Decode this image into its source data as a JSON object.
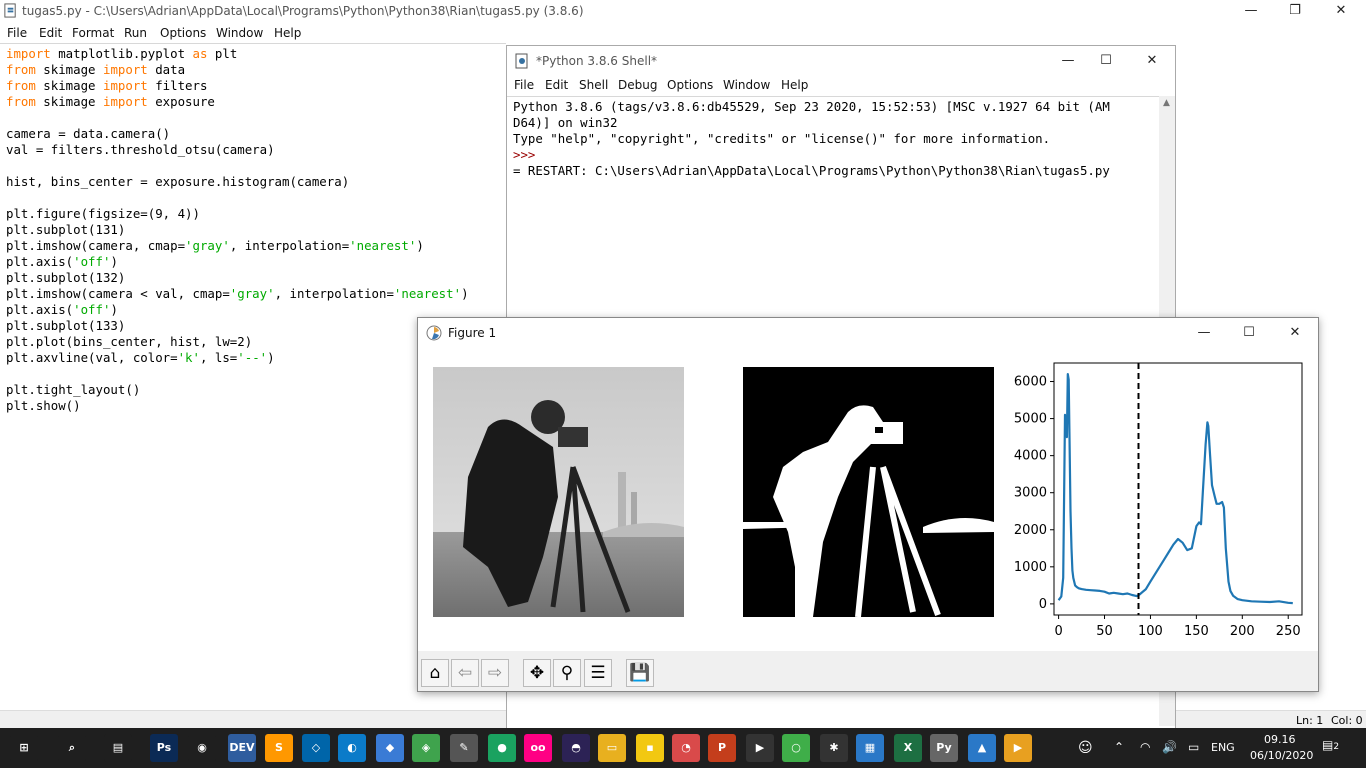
{
  "editor_window": {
    "title": "tugas5.py - C:\\Users\\Adrian\\AppData\\Local\\Programs\\Python\\Python38\\Rian\\tugas5.py (3.8.6)",
    "menu": [
      "File",
      "Edit",
      "Format",
      "Run",
      "Options",
      "Window",
      "Help"
    ],
    "code": [
      [
        {
          "t": "import",
          "c": "kw"
        },
        {
          "t": " matplotlib.pyplot ",
          "c": ""
        },
        {
          "t": "as",
          "c": "kw"
        },
        {
          "t": " plt",
          "c": ""
        }
      ],
      [
        {
          "t": "from",
          "c": "kw"
        },
        {
          "t": " skimage ",
          "c": ""
        },
        {
          "t": "import",
          "c": "kw"
        },
        {
          "t": " data",
          "c": ""
        }
      ],
      [
        {
          "t": "from",
          "c": "kw"
        },
        {
          "t": " skimage ",
          "c": ""
        },
        {
          "t": "import",
          "c": "kw"
        },
        {
          "t": " filters",
          "c": ""
        }
      ],
      [
        {
          "t": "from",
          "c": "kw"
        },
        {
          "t": " skimage ",
          "c": ""
        },
        {
          "t": "import",
          "c": "kw"
        },
        {
          "t": " exposure",
          "c": ""
        }
      ],
      [],
      [
        {
          "t": "camera = data.camera()",
          "c": ""
        }
      ],
      [
        {
          "t": "val = filters.threshold_otsu(camera)",
          "c": ""
        }
      ],
      [],
      [
        {
          "t": "hist, bins_center = exposure.histogram(camera)",
          "c": ""
        }
      ],
      [],
      [
        {
          "t": "plt.figure(figsize=(9, 4))",
          "c": ""
        }
      ],
      [
        {
          "t": "plt.subplot(131)",
          "c": ""
        }
      ],
      [
        {
          "t": "plt.imshow(camera, cmap=",
          "c": ""
        },
        {
          "t": "'gray'",
          "c": "str"
        },
        {
          "t": ", interpolation=",
          "c": ""
        },
        {
          "t": "'nearest'",
          "c": "str"
        },
        {
          "t": ")",
          "c": ""
        }
      ],
      [
        {
          "t": "plt.axis(",
          "c": ""
        },
        {
          "t": "'off'",
          "c": "str"
        },
        {
          "t": ")",
          "c": ""
        }
      ],
      [
        {
          "t": "plt.subplot(132)",
          "c": ""
        }
      ],
      [
        {
          "t": "plt.imshow(camera < val, cmap=",
          "c": ""
        },
        {
          "t": "'gray'",
          "c": "str"
        },
        {
          "t": ", interpolation=",
          "c": ""
        },
        {
          "t": "'nearest'",
          "c": "str"
        },
        {
          "t": ")",
          "c": ""
        }
      ],
      [
        {
          "t": "plt.axis(",
          "c": ""
        },
        {
          "t": "'off'",
          "c": "str"
        },
        {
          "t": ")",
          "c": ""
        }
      ],
      [
        {
          "t": "plt.subplot(133)",
          "c": ""
        }
      ],
      [
        {
          "t": "plt.plot(bins_center, hist, lw=2)",
          "c": ""
        }
      ],
      [
        {
          "t": "plt.axvline(val, color=",
          "c": ""
        },
        {
          "t": "'k'",
          "c": "str"
        },
        {
          "t": ", ls=",
          "c": ""
        },
        {
          "t": "'--'",
          "c": "str"
        },
        {
          "t": ")",
          "c": ""
        }
      ],
      [],
      [
        {
          "t": "plt.tight_layout()",
          "c": ""
        }
      ],
      [
        {
          "t": "plt.show()",
          "c": ""
        }
      ]
    ],
    "status": {
      "line": "Ln: 1",
      "col": "Col: 0"
    }
  },
  "shell_window": {
    "title": "*Python 3.8.6 Shell*",
    "menu": [
      "File",
      "Edit",
      "Shell",
      "Debug",
      "Options",
      "Window",
      "Help"
    ],
    "lines": [
      "Python 3.8.6 (tags/v3.8.6:db45529, Sep 23 2020, 15:52:53) [MSC v.1927 64 bit (AM",
      "D64)] on win32",
      "Type \"help\", \"copyright\", \"credits\" or \"license()\" for more information.",
      ">>>",
      "= RESTART: C:\\Users\\Adrian\\AppData\\Local\\Programs\\Python\\Python38\\Rian\\tugas5.py"
    ]
  },
  "figure_window": {
    "title": "Figure 1",
    "toolbar_icons": [
      "home-icon",
      "back-arrow-icon",
      "forward-arrow-icon",
      "pan-icon",
      "zoom-icon",
      "configure-subplots-icon",
      "save-icon"
    ]
  },
  "chart_data": {
    "type": "line",
    "title": "",
    "xlabel": "",
    "ylabel": "",
    "x_ticks": [
      "0",
      "50",
      "100",
      "150",
      "200",
      "250"
    ],
    "y_ticks": [
      "0",
      "1000",
      "2000",
      "3000",
      "4000",
      "5000",
      "6000"
    ],
    "xlim": [
      -5,
      265
    ],
    "ylim": [
      -300,
      6500
    ],
    "series": [
      {
        "color": "#1f77b4",
        "x": [
          0,
          3,
          5,
          7,
          9,
          10,
          11,
          12,
          13,
          14,
          15,
          16,
          17,
          18,
          20,
          22,
          25,
          30,
          35,
          40,
          45,
          50,
          55,
          60,
          65,
          70,
          75,
          80,
          85,
          88,
          95,
          100,
          105,
          110,
          115,
          120,
          125,
          130,
          135,
          140,
          145,
          150,
          153,
          155,
          157,
          160,
          162,
          163,
          165,
          167,
          170,
          172,
          175,
          178,
          180,
          182,
          185,
          187,
          190,
          195,
          200,
          210,
          220,
          230,
          240,
          250,
          255
        ],
        "y": [
          100,
          200,
          700,
          5100,
          4500,
          6200,
          6050,
          4300,
          2500,
          1500,
          900,
          700,
          600,
          500,
          450,
          420,
          400,
          380,
          370,
          360,
          350,
          330,
          280,
          300,
          280,
          260,
          280,
          240,
          210,
          250,
          400,
          600,
          800,
          1000,
          1200,
          1400,
          1600,
          1750,
          1650,
          1450,
          1500,
          2100,
          2200,
          2150,
          3000,
          4300,
          4900,
          4800,
          4000,
          3200,
          2900,
          2700,
          2700,
          2750,
          2600,
          1500,
          600,
          350,
          220,
          130,
          100,
          70,
          60,
          50,
          70,
          30,
          20
        ]
      }
    ],
    "threshold_line": {
      "x": 87,
      "style": "dashed",
      "color": "#000000"
    }
  },
  "taskbar": {
    "icons": [
      "windows-start-icon",
      "search-icon",
      "task-view-icon",
      "photoshop-icon",
      "chrome-icon",
      "dev-cpp-icon",
      "sublime-text-icon",
      "vscode-icon",
      "edge-icon",
      "3d-viewer-icon",
      "inkscape-icon",
      "settings-tools-icon",
      "app-icon",
      "flickr-icon",
      "eclipse-icon",
      "file-explorer-icon",
      "sticky-notes-icon",
      "snipping-tool-icon",
      "powerpoint-icon",
      "terminal-icon",
      "app-ring-icon",
      "network-app-icon",
      "app-blue-icon",
      "excel-icon",
      "python-idle-icon",
      "photos-icon",
      "media-player-icon"
    ],
    "tray": {
      "lang": "ENG",
      "time": "09.16",
      "date": "06/10/2020",
      "notification_count": "2"
    }
  }
}
